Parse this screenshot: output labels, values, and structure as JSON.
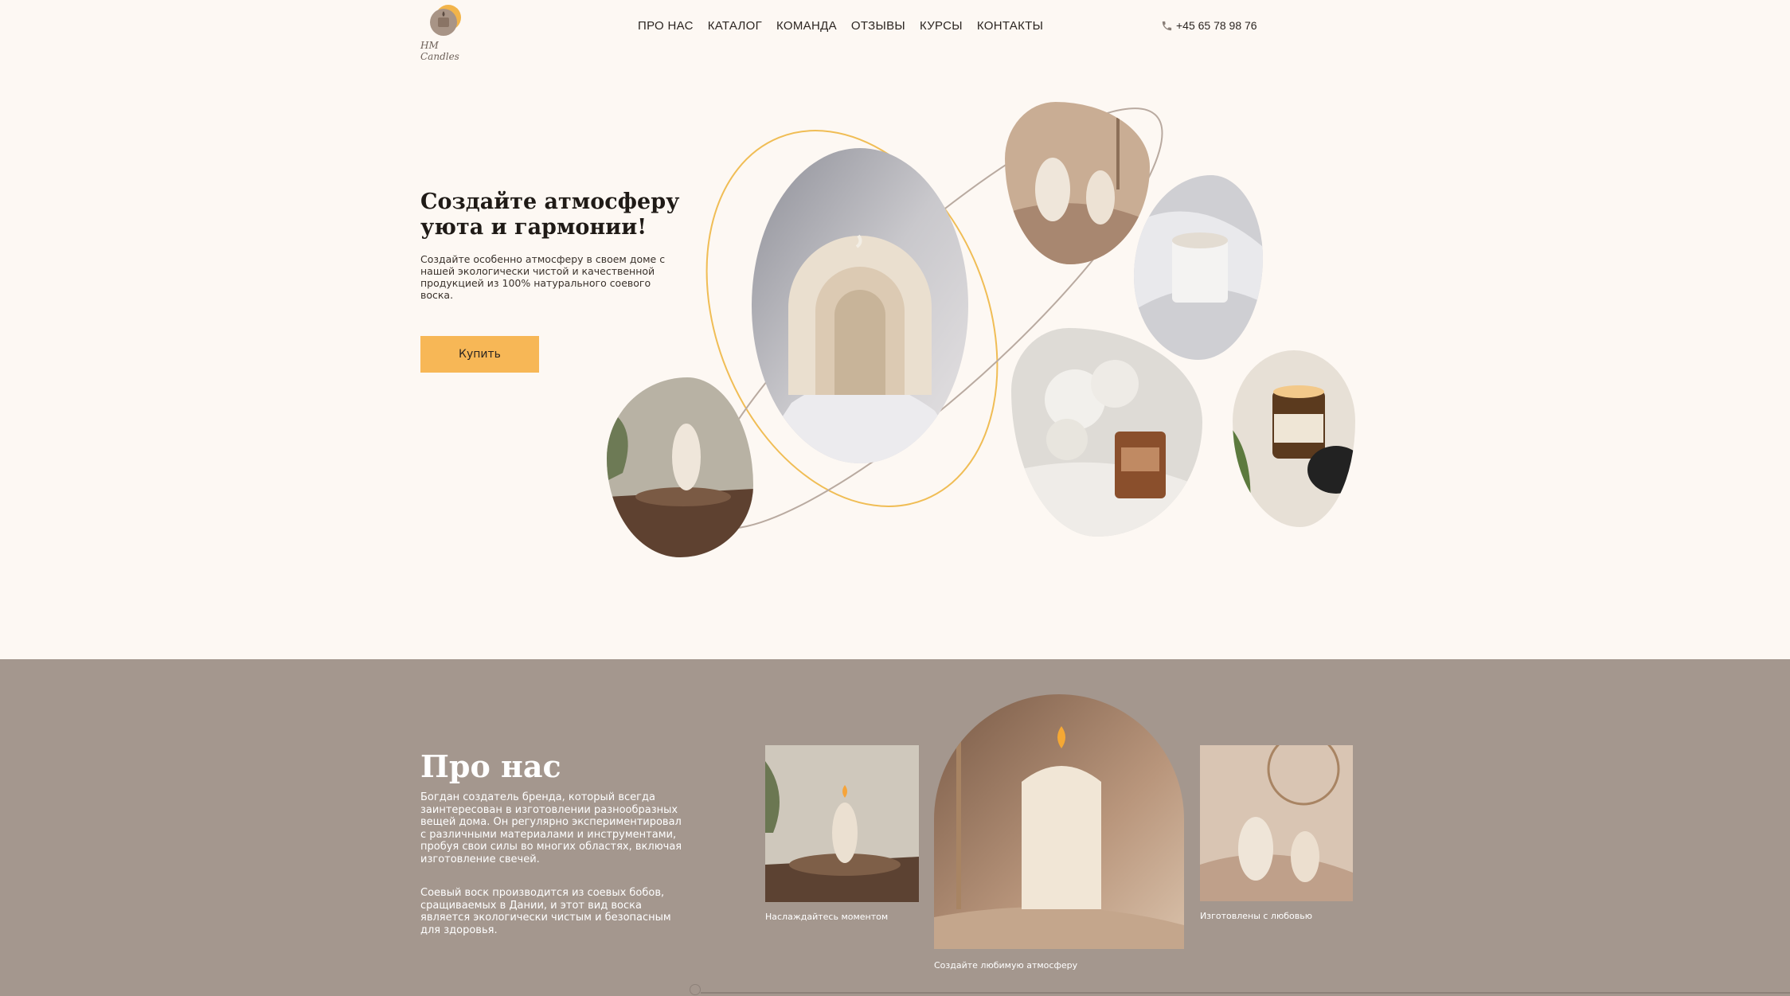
{
  "brand": {
    "logo_text": "HM Candles"
  },
  "nav": {
    "items": [
      {
        "label": "ПРО НАС"
      },
      {
        "label": "КАТАЛОГ"
      },
      {
        "label": "КОМАНДА"
      },
      {
        "label": "ОТЗЫВЫ"
      },
      {
        "label": "КУРСЫ"
      },
      {
        "label": "КОНТАКТЫ"
      }
    ]
  },
  "header": {
    "phone": "+45 65 78 98 76"
  },
  "hero": {
    "title": "Создайте атмосферу уюта и гармонии!",
    "text": "Создайте особенно атмосферу в своем доме с нашей экологически чистой и качественной продукцией из 100% натурального соевого воска.",
    "buy_label": "Купить"
  },
  "about": {
    "title": "Про нас",
    "paragraph_1": "Богдан создатель бренда, который всегда заинтересован в изготовлении разнообразных вещей дома. Он регулярно экспериментировал с различными материалами и инструментами, пробуя свои силы во многих областях, включая изготовление свечей.",
    "paragraph_2": "Соевый воск производится из соевых бобов, сращиваемых в Дании, и этот вид воска является экологически чистым и безопасным для здоровья.",
    "captions": {
      "left": "Наслаждайтесь моментом",
      "center": "Создайте любимую атмосферу",
      "right": "Изготовлены с любовью"
    }
  },
  "colors": {
    "background": "#fdf8f3",
    "accent": "#f7b756",
    "about_bg": "#a4978e"
  }
}
